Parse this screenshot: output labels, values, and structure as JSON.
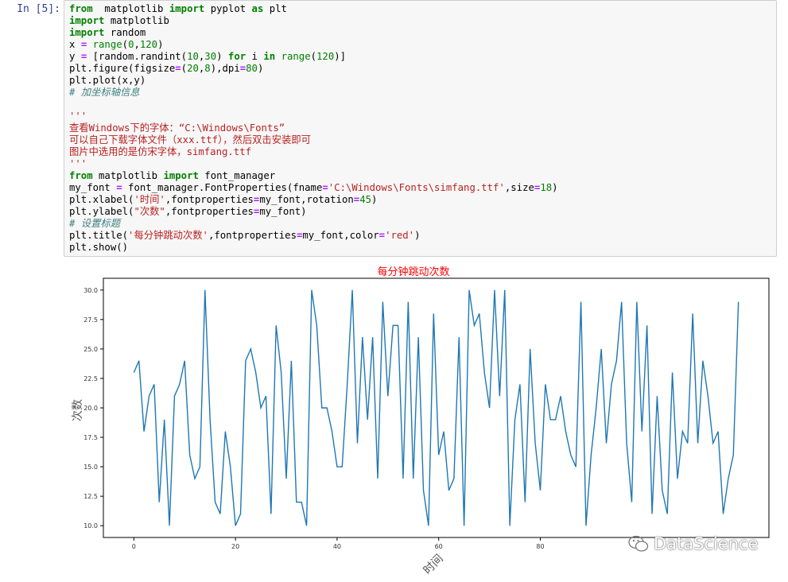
{
  "cell": {
    "prompt": "In  [5]:",
    "lines": [
      [
        [
          "kw",
          "from"
        ],
        [
          "",
          "  matplotlib "
        ],
        [
          "kw",
          "import"
        ],
        [
          "",
          " pyplot "
        ],
        [
          "kw",
          "as"
        ],
        [
          "",
          " plt"
        ]
      ],
      [
        [
          "kw",
          "import"
        ],
        [
          "",
          " matplotlib"
        ]
      ],
      [
        [
          "kw",
          "import"
        ],
        [
          "",
          " random"
        ]
      ],
      [
        [
          "",
          "x "
        ],
        [
          "op",
          "="
        ],
        [
          "",
          " "
        ],
        [
          "builtin",
          "range"
        ],
        [
          "",
          "("
        ],
        [
          "num",
          "0"
        ],
        [
          "",
          ","
        ],
        [
          "num",
          "120"
        ],
        [
          "",
          ")"
        ]
      ],
      [
        [
          "",
          "y "
        ],
        [
          "op",
          "="
        ],
        [
          "",
          " [random.randint("
        ],
        [
          "num",
          "10"
        ],
        [
          "",
          ","
        ],
        [
          "num",
          "30"
        ],
        [
          "",
          ") "
        ],
        [
          "kw",
          "for"
        ],
        [
          "",
          " i "
        ],
        [
          "kw",
          "in"
        ],
        [
          "",
          " "
        ],
        [
          "builtin",
          "range"
        ],
        [
          "",
          "("
        ],
        [
          "num",
          "120"
        ],
        [
          "",
          ")]"
        ]
      ],
      [
        [
          "",
          "plt.figure(figsize"
        ],
        [
          "op",
          "="
        ],
        [
          "",
          "("
        ],
        [
          "num",
          "20"
        ],
        [
          "",
          ","
        ],
        [
          "num",
          "8"
        ],
        [
          "",
          "),dpi"
        ],
        [
          "op",
          "="
        ],
        [
          "num",
          "80"
        ],
        [
          "",
          ")"
        ]
      ],
      [
        [
          "",
          "plt.plot(x,y)"
        ]
      ],
      [
        [
          "comment",
          "# 加坐标轴信息"
        ]
      ],
      [
        [
          "",
          ""
        ]
      ],
      [
        [
          "str",
          "'''"
        ]
      ],
      [
        [
          "str",
          "查看Windows下的字体：“C:\\Windows\\Fonts”"
        ]
      ],
      [
        [
          "str",
          "可以自己下载字体文件（xxx.ttf），然后双击安装即可"
        ]
      ],
      [
        [
          "str",
          "图片中选用的是仿宋字体，simfang.ttf"
        ]
      ],
      [
        [
          "str",
          "'''"
        ]
      ],
      [
        [
          "kw",
          "from"
        ],
        [
          "",
          " matplotlib "
        ],
        [
          "kw",
          "import"
        ],
        [
          "",
          " font_manager"
        ]
      ],
      [
        [
          "",
          "my_font "
        ],
        [
          "op",
          "="
        ],
        [
          "",
          " font_manager.FontProperties(fname"
        ],
        [
          "op",
          "="
        ],
        [
          "str",
          "'C:\\Windows\\Fonts\\simfang.ttf'"
        ],
        [
          "",
          ",size"
        ],
        [
          "op",
          "="
        ],
        [
          "num",
          "18"
        ],
        [
          "",
          ")"
        ]
      ],
      [
        [
          "",
          "plt.xlabel("
        ],
        [
          "str",
          "'时间'"
        ],
        [
          "",
          ",fontproperties"
        ],
        [
          "op",
          "="
        ],
        [
          "",
          "my_font,rotation"
        ],
        [
          "op",
          "="
        ],
        [
          "num",
          "45"
        ],
        [
          "",
          ")"
        ]
      ],
      [
        [
          "",
          "plt.ylabel("
        ],
        [
          "str",
          "\"次数\""
        ],
        [
          "",
          ",fontproperties"
        ],
        [
          "op",
          "="
        ],
        [
          "",
          "my_font)"
        ]
      ],
      [
        [
          "comment",
          "# 设置标题"
        ]
      ],
      [
        [
          "",
          "plt.title("
        ],
        [
          "str",
          "'每分钟跳动次数'"
        ],
        [
          "",
          ",fontproperties"
        ],
        [
          "op",
          "="
        ],
        [
          "",
          "my_font,color"
        ],
        [
          "op",
          "="
        ],
        [
          "str",
          "'red'"
        ],
        [
          "",
          ")"
        ]
      ],
      [
        [
          "",
          "plt.show()"
        ]
      ]
    ]
  },
  "chart_data": {
    "type": "line",
    "title": "每分钟跳动次数",
    "title_color": "#ff0000",
    "xlabel": "时间",
    "ylabel": "次数",
    "line_color": "#1f77b4",
    "xlim": [
      -6,
      125
    ],
    "ylim": [
      9,
      31
    ],
    "xticks": [
      0,
      20,
      40,
      60,
      80
    ],
    "yticks": [
      10.0,
      12.5,
      15.0,
      17.5,
      20.0,
      22.5,
      25.0,
      27.5,
      30.0
    ],
    "x_start": 0,
    "values": [
      23,
      24,
      18,
      21,
      22,
      12,
      19,
      10,
      21,
      22,
      24,
      16,
      14,
      15,
      30,
      19,
      12,
      11,
      18,
      15,
      10,
      11,
      24,
      25,
      23,
      20,
      21,
      11,
      27,
      23,
      14,
      24,
      12,
      12,
      10,
      30,
      27,
      20,
      20,
      18,
      15,
      15,
      22,
      30,
      17,
      26,
      19,
      26,
      14,
      29,
      21,
      27,
      27,
      14,
      29,
      14,
      26,
      13,
      10,
      28,
      16,
      18,
      13,
      14,
      26,
      10,
      30,
      27,
      28,
      23,
      20,
      30,
      21,
      30,
      10,
      19,
      22,
      12,
      25,
      17,
      13,
      22,
      19,
      19,
      21,
      18,
      16,
      15,
      29,
      10,
      16,
      20,
      25,
      17,
      22,
      24,
      29,
      17,
      12,
      29,
      18,
      27,
      11,
      21,
      13,
      11,
      23,
      14,
      18,
      17,
      28,
      17,
      24,
      21,
      17,
      18,
      11,
      14,
      16,
      29
    ]
  },
  "watermark": {
    "text": "DataScience"
  }
}
